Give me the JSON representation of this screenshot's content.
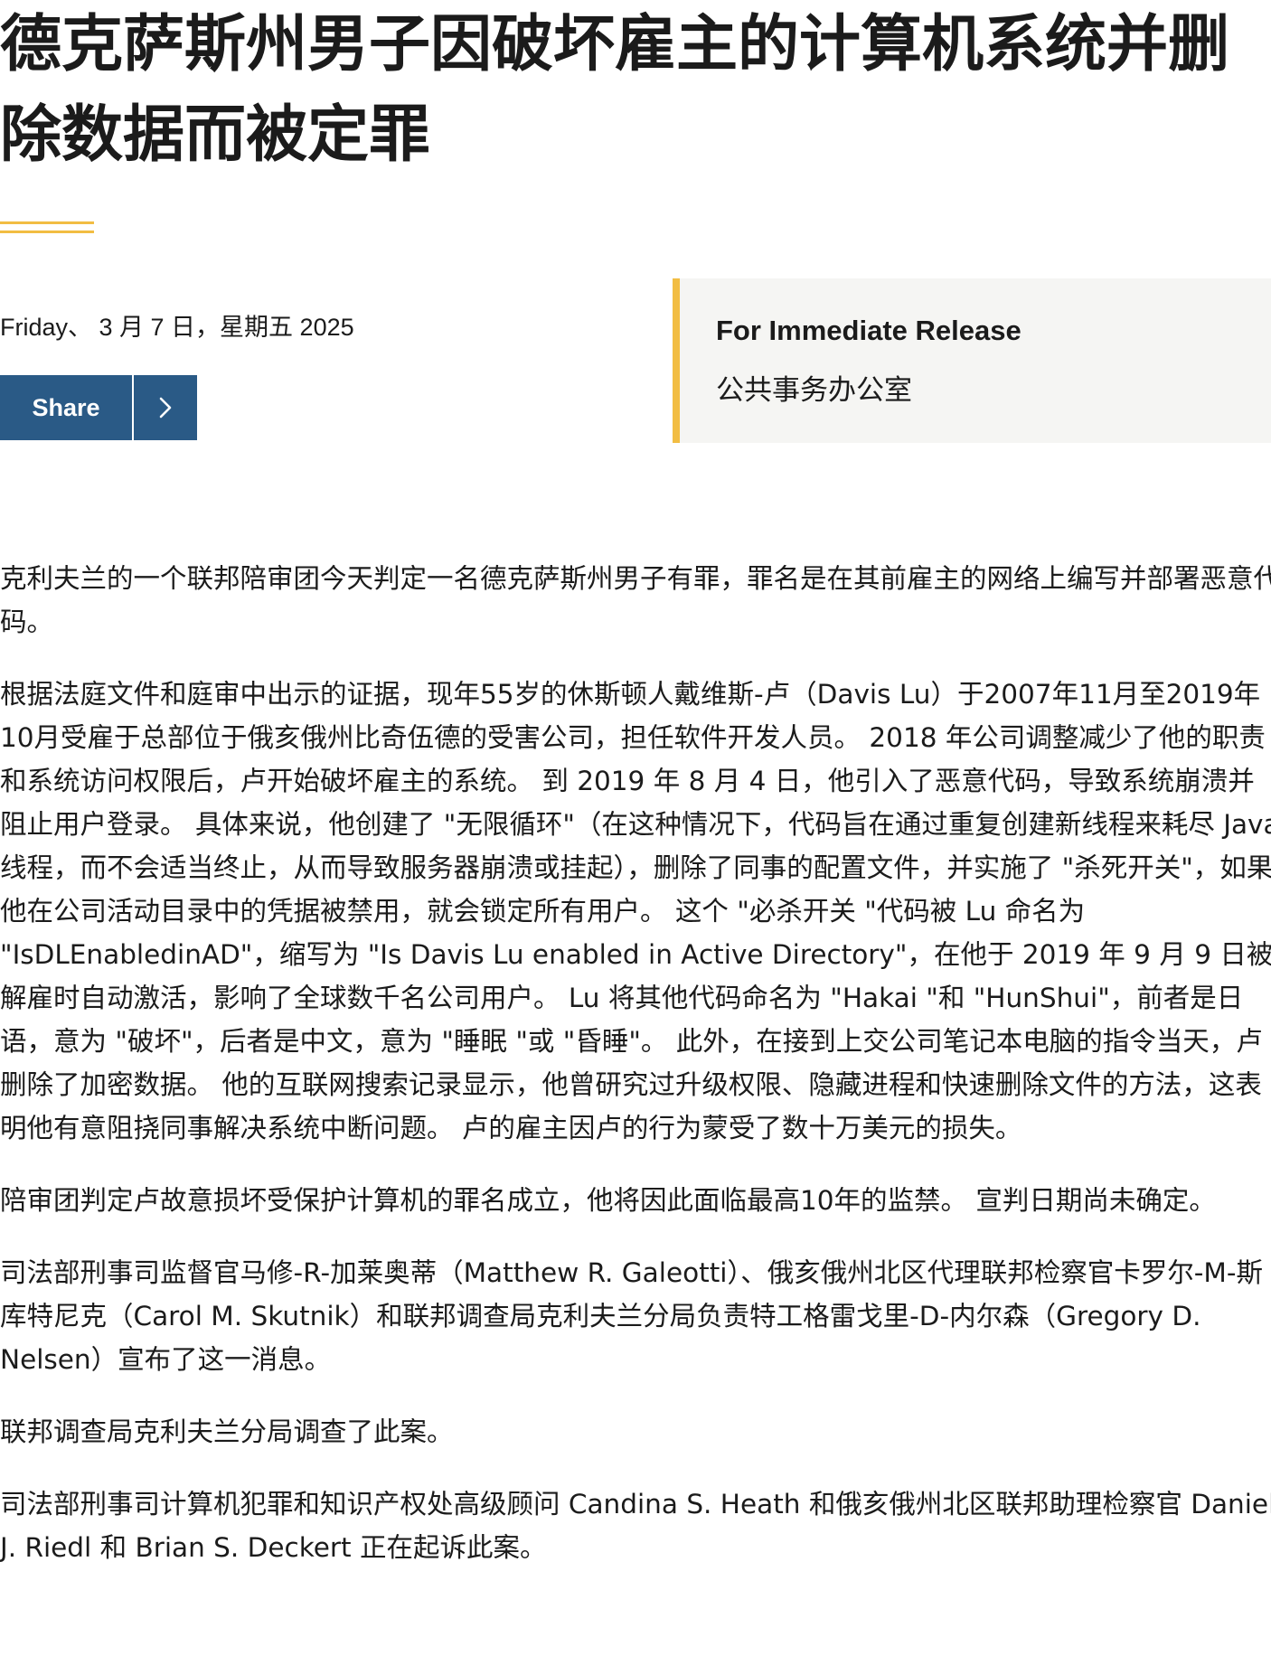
{
  "article": {
    "title": "德克萨斯州男子因破坏雇主的计算机系统并删除数据而被定罪",
    "date": "Friday、 3 月 7 日，星期五 2025",
    "share_label": "Share",
    "release": {
      "heading": "For Immediate Release",
      "office": "公共事务办公室"
    },
    "paragraphs": [
      "克利夫兰的一个联邦陪审团今天判定一名德克萨斯州男子有罪，罪名是在其前雇主的网络上编写并部署恶意代码。",
      "根据法庭文件和庭审中出示的证据，现年55岁的休斯顿人戴维斯-卢（Davis Lu）于2007年11月至2019年10月受雇于总部位于俄亥俄州比奇伍德的受害公司，担任软件开发人员。 2018 年公司调整减少了他的职责和系统访问权限后，卢开始破坏雇主的系统。 到 2019 年 8 月 4 日，他引入了恶意代码，导致系统崩溃并阻止用户登录。 具体来说，他创建了 \"无限循环\"（在这种情况下，代码旨在通过重复创建新线程来耗尽 Java 线程，而不会适当终止，从而导致服务器崩溃或挂起），删除了同事的配置文件，并实施了 \"杀死开关\"，如果他在公司活动目录中的凭据被禁用，就会锁定所有用户。 这个 \"必杀开关 \"代码被 Lu 命名为 \"IsDLEnabledinAD\"，缩写为 \"Is Davis Lu enabled in Active Directory\"，在他于 2019 年 9 月 9 日被解雇时自动激活，影响了全球数千名公司用户。 Lu 将其他代码命名为 \"Hakai \"和 \"HunShui\"，前者是日语，意为 \"破坏\"，后者是中文，意为 \"睡眠 \"或 \"昏睡\"。 此外，在接到上交公司笔记本电脑的指令当天，卢删除了加密数据。 他的互联网搜索记录显示，他曾研究过升级权限、隐藏进程和快速删除文件的方法，这表明他有意阻挠同事解决系统中断问题。 卢的雇主因卢的行为蒙受了数十万美元的损失。",
      "陪审团判定卢故意损坏受保护计算机的罪名成立，他将因此面临最高10年的监禁。 宣判日期尚未确定。",
      "司法部刑事司监督官马修-R-加莱奥蒂（Matthew R. Galeotti）、俄亥俄州北区代理联邦检察官卡罗尔-M-斯库特尼克（Carol M. Skutnik）和联邦调查局克利夫兰分局负责特工格雷戈里-D-内尔森（Gregory D. Nelsen）宣布了这一消息。",
      "联邦调查局克利夫兰分局调查了此案。",
      "司法部刑事司计算机犯罪和知识产权处高级顾问 Candina S. Heath 和俄亥俄州北区联邦助理检察官 Daniel J. Riedl 和 Brian S. Deckert 正在起诉此案。"
    ]
  },
  "icons": {
    "share_arrow": "chevron-right-icon"
  },
  "colors": {
    "accent_gold": "#f2bd43",
    "share_blue": "#2a5a86",
    "box_bg": "#f5f5f3",
    "text": "#1b1b1b"
  }
}
